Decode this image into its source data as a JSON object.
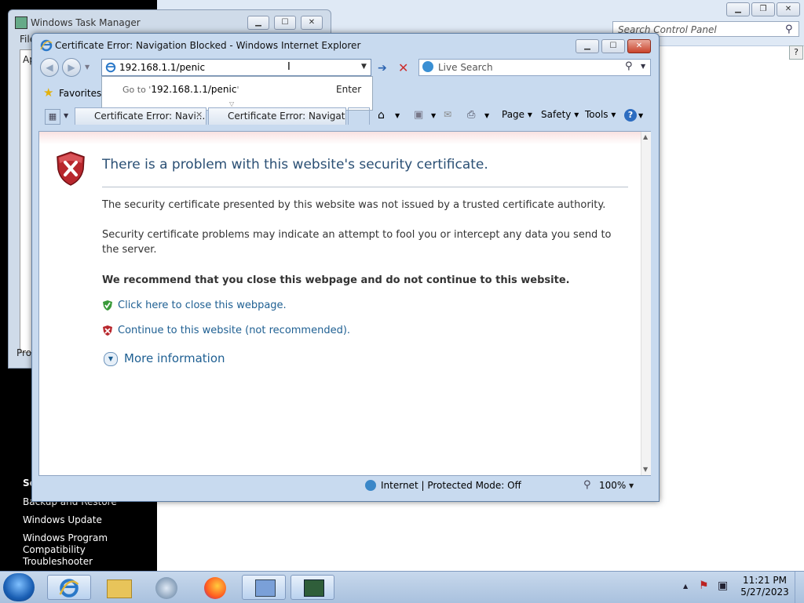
{
  "control_panel": {
    "search_placeholder": "Search Control Panel",
    "sidebar_links": [
      "Backup and Restore",
      "Windows Update",
      "Windows Program Compatibility Troubleshooter"
    ],
    "sidebar_partial_heading": "Se"
  },
  "task_manager": {
    "title": "Windows Task Manager",
    "menu_partial": "File",
    "tab_partial": "Ap",
    "status_partial": "Pro"
  },
  "ie": {
    "title": "Certificate Error: Navigation Blocked - Windows Internet Explorer",
    "address_value": "192.168.1.1/penic",
    "search_placeholder": "Live Search",
    "suggestion": {
      "goto_prefix": "Go to '",
      "goto_value": "192.168.1.1/penic",
      "goto_suffix": "'",
      "enter": "Enter"
    },
    "favorites": "Favorites",
    "tabs": [
      "Certificate Error: Navi...",
      "Certificate Error: Navigati..."
    ],
    "toolbar": {
      "page": "Page",
      "safety": "Safety",
      "tools": "Tools"
    },
    "content": {
      "headline": "There is a problem with this website's security certificate.",
      "para1": "The security certificate presented by this website was not issued by a trusted certificate authority.",
      "para2": "Security certificate problems may indicate an attempt to fool you or intercept any data you send to the server.",
      "recommend": "We recommend that you close this webpage and do not continue to this website.",
      "close_link": "Click here to close this webpage.",
      "continue_link": "Continue to this website (not recommended).",
      "more_info": "More information"
    },
    "status": {
      "zone": "Internet | Protected Mode: Off",
      "zoom": "100%"
    }
  },
  "taskbar": {
    "time": "11:21 PM",
    "date": "5/27/2023"
  },
  "colors": {
    "link": "#1e5f92",
    "headline": "#2a4f74",
    "close_btn": "#c9432b"
  }
}
